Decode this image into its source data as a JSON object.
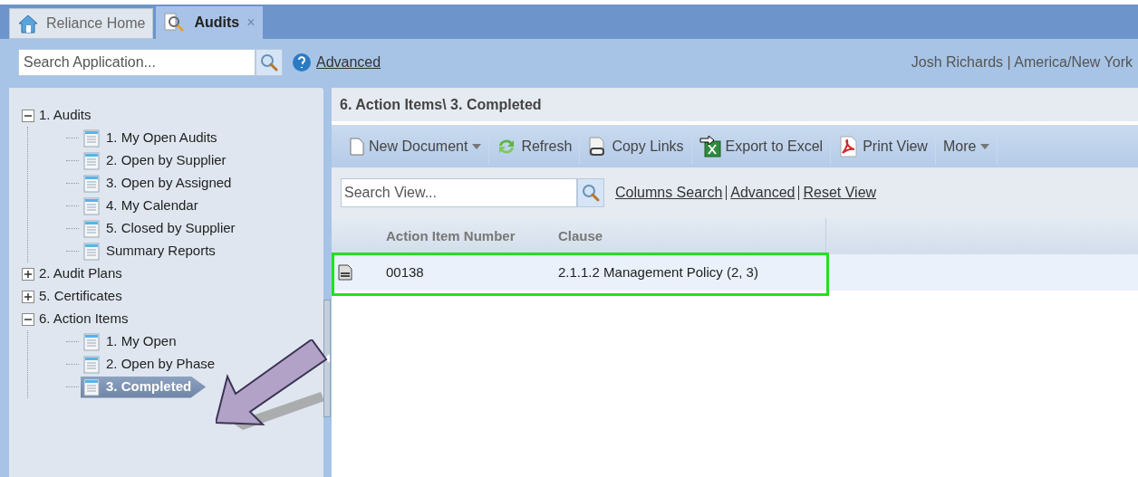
{
  "tabs": [
    {
      "label": "Reliance Home",
      "selected": false
    },
    {
      "label": "Audits",
      "selected": true,
      "close": "×"
    }
  ],
  "search": {
    "placeholder": "Search Application...",
    "advanced": "Advanced"
  },
  "user": "Josh Richards | America/New York",
  "tree": [
    {
      "label": "1. Audits",
      "expanded": true,
      "children": [
        {
          "label": "1. My Open Audits",
          "selected": false
        },
        {
          "label": "2. Open by Supplier",
          "selected": false
        },
        {
          "label": "3. Open by Assigned",
          "selected": false
        },
        {
          "label": "4. My Calendar",
          "selected": false
        },
        {
          "label": "5. Closed by Supplier",
          "selected": false
        },
        {
          "label": "Summary Reports",
          "selected": false
        }
      ]
    },
    {
      "label": "2. Audit Plans",
      "expanded": false
    },
    {
      "label": "5. Certificates",
      "expanded": false
    },
    {
      "label": "6. Action Items",
      "expanded": true,
      "children": [
        {
          "label": "1. My Open",
          "selected": false
        },
        {
          "label": "2. Open by Phase",
          "selected": false
        },
        {
          "label": "3. Completed",
          "selected": true
        }
      ]
    }
  ],
  "view": {
    "title": "6. Action Items\\ 3. Completed",
    "toolbar": [
      {
        "label": "New Document",
        "dropdown": true
      },
      {
        "label": "Refresh",
        "dropdown": false
      },
      {
        "label": "Copy Links",
        "dropdown": false
      },
      {
        "label": "Export to Excel",
        "dropdown": false
      },
      {
        "label": "Print View",
        "dropdown": false
      },
      {
        "label": "More",
        "dropdown": true
      }
    ],
    "search_placeholder": "Search View...",
    "links": [
      "Columns Search",
      "Advanced",
      "Reset View"
    ],
    "columns": [
      "Action Item Number",
      "Clause"
    ],
    "rows": [
      {
        "cells": [
          "00138",
          "2.1.1.2 Management Policy (2, 3)"
        ],
        "highlighted": true
      }
    ]
  }
}
